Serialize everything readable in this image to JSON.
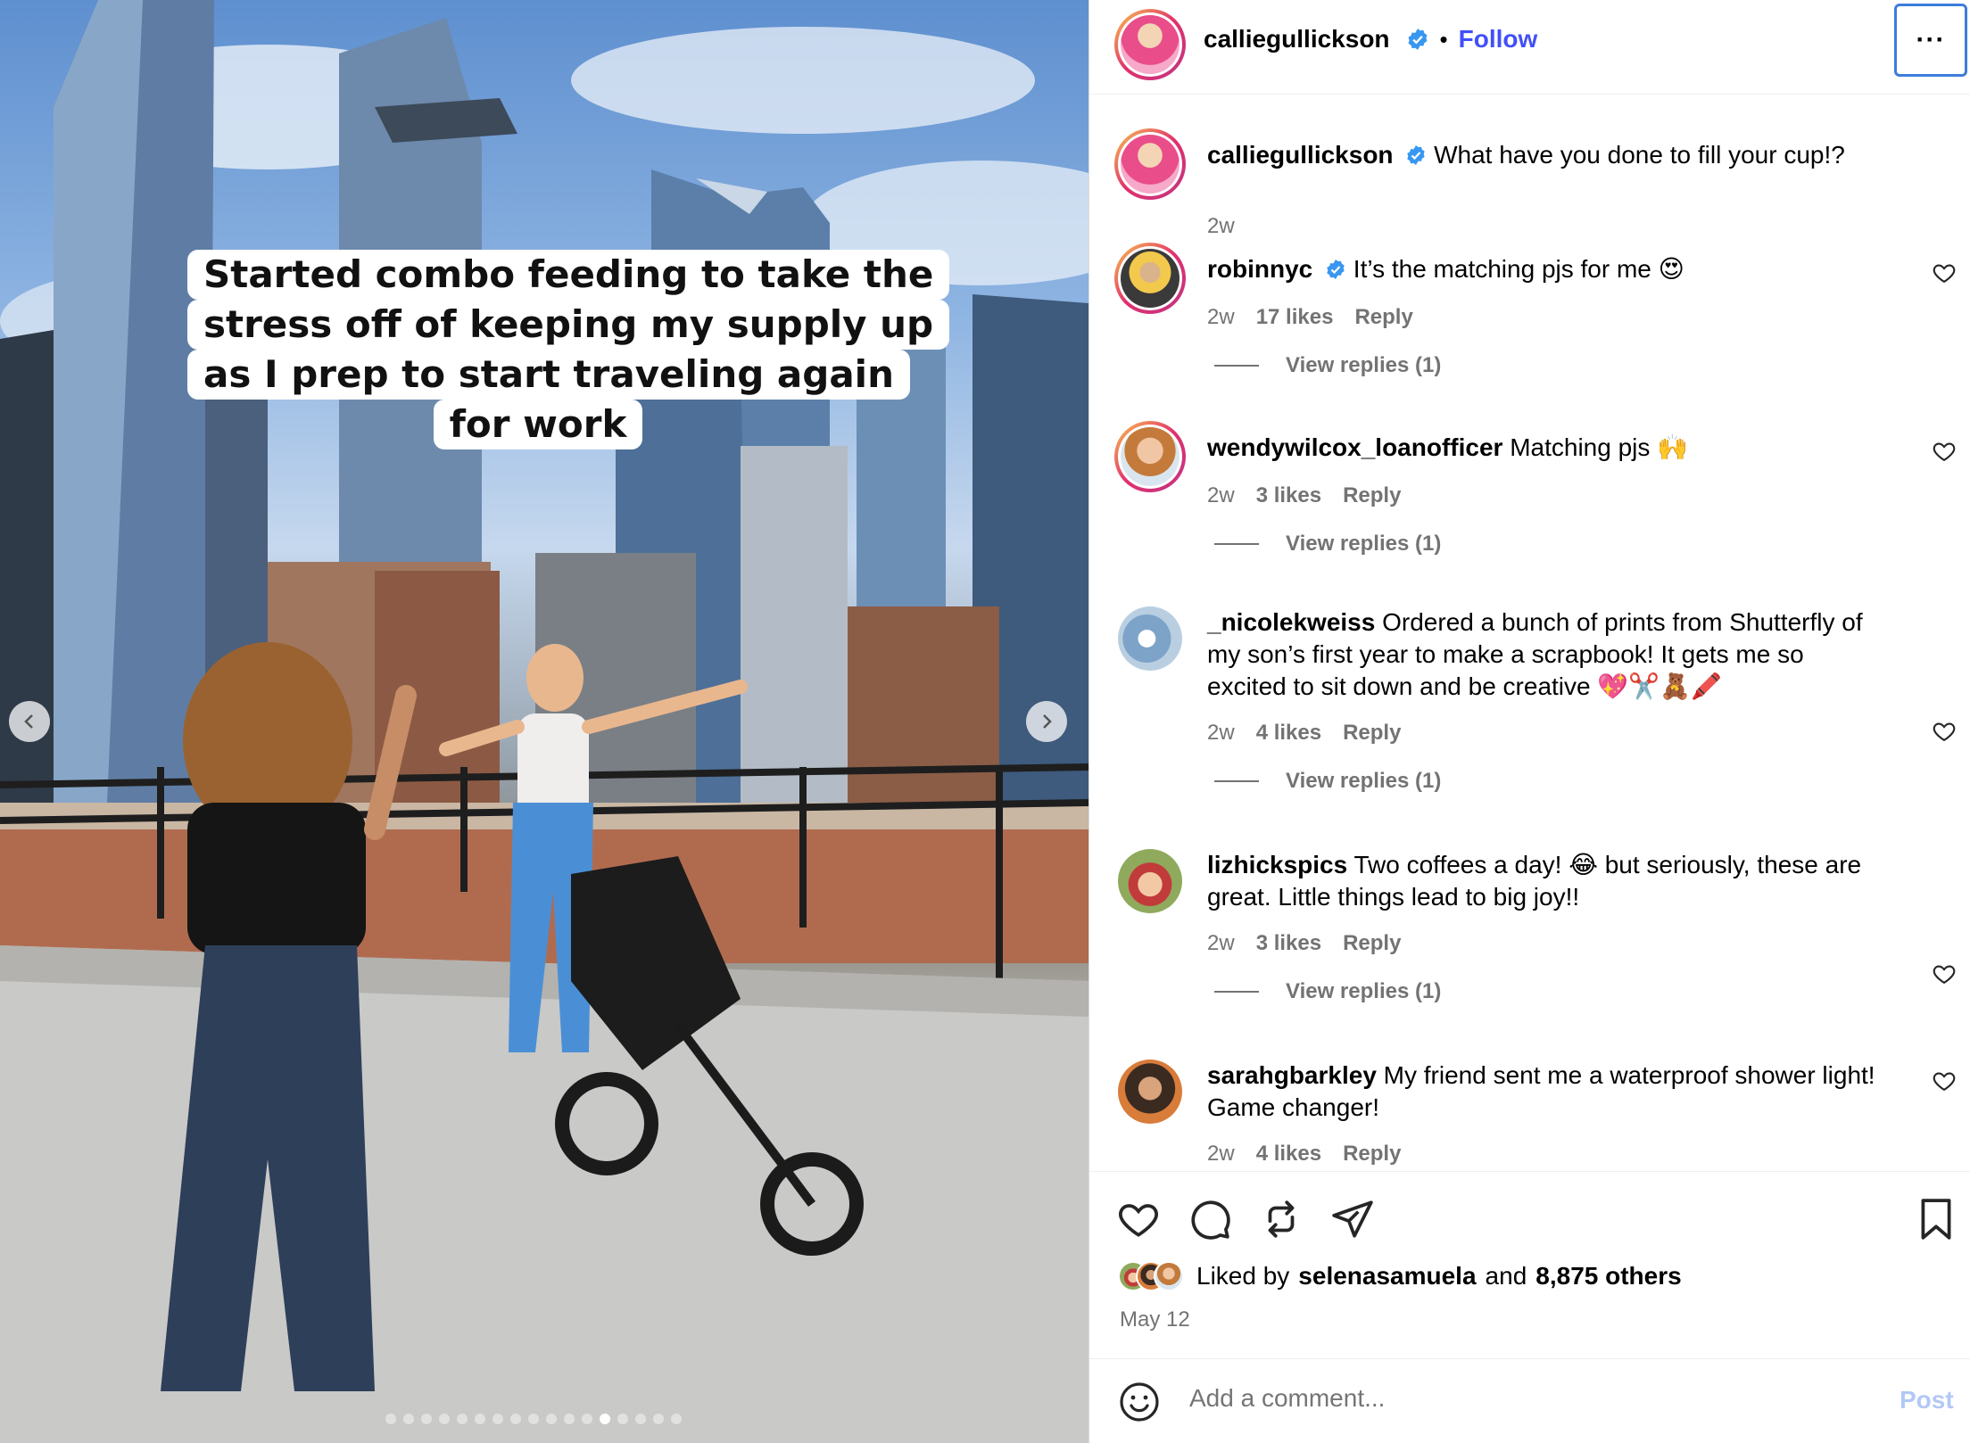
{
  "post": {
    "caption_overlay": [
      "Started combo feeding to take the",
      "stress off of keeping my supply up",
      "as I prep to start traveling again",
      "for work"
    ],
    "carousel_total": 17,
    "carousel_active_index": 12
  },
  "header": {
    "username": "calliegullickson",
    "separator": "•",
    "follow_label": "Follow",
    "more_label": "···"
  },
  "comments": [
    {
      "username": "calliegullickson",
      "verified": true,
      "text": "What have you done to fill your cup!?",
      "time": "2w"
    },
    {
      "username": "robinnyc",
      "verified": true,
      "text": "It’s the matching pjs for me 😍",
      "time": "2w",
      "likes": "17 likes",
      "reply_label": "Reply",
      "view_replies": "View replies (1)"
    },
    {
      "username": "wendywilcox_loanofficer",
      "verified": false,
      "text": "Matching pjs 🙌",
      "time": "2w",
      "likes": "3 likes",
      "reply_label": "Reply",
      "view_replies": "View replies (1)"
    },
    {
      "username": "_nicolekweiss",
      "verified": false,
      "text": "Ordered a bunch of prints from Shutterfly of my son’s first year to make a scrapbook! It gets me so excited to sit down and be creative 💖✂️🧸🖍️",
      "time": "2w",
      "likes": "4 likes",
      "reply_label": "Reply",
      "view_replies": "View replies (1)"
    },
    {
      "username": "lizhickspics",
      "verified": false,
      "text": "Two coffees a day! 😂 but seriously, these are great. Little things lead to big joy!!",
      "time": "2w",
      "likes": "3 likes",
      "reply_label": "Reply",
      "view_replies": "View replies (1)"
    },
    {
      "username": "sarahgbarkley",
      "verified": false,
      "text": "My friend sent me a waterproof shower light! Game changer!",
      "time": "2w",
      "likes": "4 likes",
      "reply_label": "Reply"
    }
  ],
  "actions": {
    "liked_prefix": "Liked by",
    "liked_user": "selenasamuela",
    "liked_and": "and",
    "liked_others": "8,875 others",
    "date": "May 12"
  },
  "composer": {
    "placeholder": "Add a comment...",
    "post_label": "Post"
  },
  "colors": {
    "accent": "#4150f7",
    "verified": "#3897f0",
    "muted": "#737373"
  }
}
